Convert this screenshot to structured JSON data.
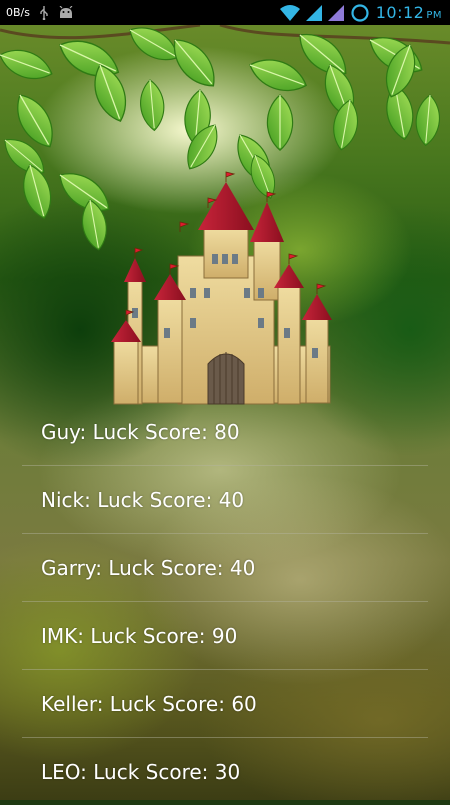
{
  "status_bar": {
    "net_speed": "0B/s",
    "time": "10:12",
    "ampm": "PM",
    "accent_color": "#33b5e5",
    "icons": [
      "usb-icon",
      "android-icon",
      "wifi-icon",
      "signal-icon",
      "signal-icon-2",
      "sync-icon"
    ]
  },
  "scores": [
    {
      "text": "Guy: Luck Score: 80"
    },
    {
      "text": "Nick: Luck Score: 40"
    },
    {
      "text": "Garry: Luck Score: 40"
    },
    {
      "text": "IMK: Luck Score: 90"
    },
    {
      "text": "Keller: Luck Score: 60"
    },
    {
      "text": "LEO: Luck Score: 30"
    }
  ]
}
